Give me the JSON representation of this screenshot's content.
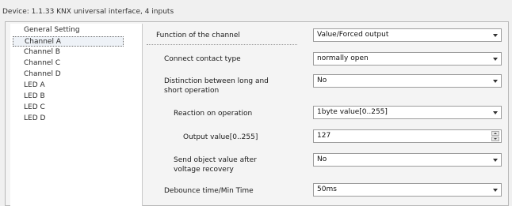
{
  "window": {
    "title": "Device: 1.1.33  KNX universal interface, 4 inputs"
  },
  "sidebar": {
    "items": [
      {
        "label": "General Setting"
      },
      {
        "label": "Channel A"
      },
      {
        "label": "Channel B"
      },
      {
        "label": "Channel C"
      },
      {
        "label": "Channel D"
      },
      {
        "label": "LED A"
      },
      {
        "label": "LED B"
      },
      {
        "label": "LED C"
      },
      {
        "label": "LED D"
      }
    ],
    "selected": "Channel A"
  },
  "params": {
    "function": {
      "label": "Function of the channel",
      "value": "Value/Forced output"
    },
    "contact": {
      "label": "Connect contact type",
      "value": "normally open"
    },
    "distinction": {
      "label_line1": "Distinction between long and",
      "label_line2": "short operation",
      "value": "No"
    },
    "reaction": {
      "label": "Reaction on operation",
      "value": "1byte value[0..255]"
    },
    "output": {
      "label": "Output value[0..255]",
      "value": "127"
    },
    "send": {
      "label_line1": "Send object value after",
      "label_line2": "voltage recovery",
      "value": "No"
    },
    "debounce": {
      "label": "Debounce time/Min Time",
      "value": "50ms"
    }
  }
}
